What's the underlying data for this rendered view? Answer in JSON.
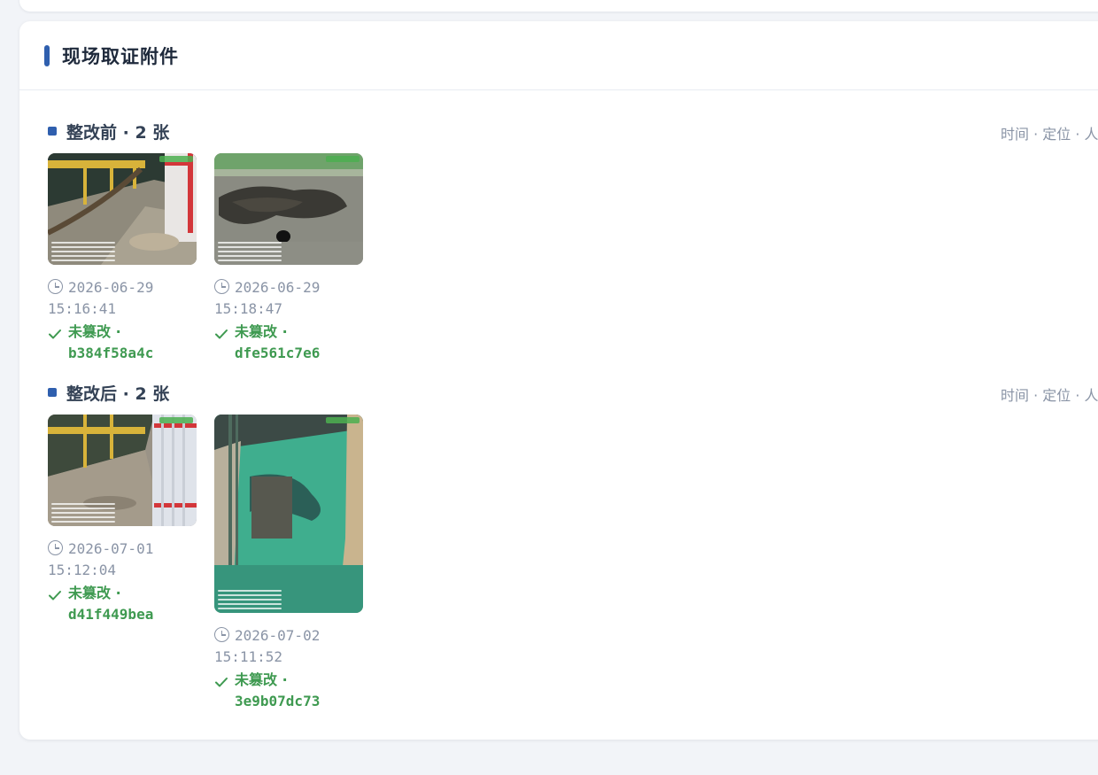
{
  "section": {
    "title": "现场取证附件"
  },
  "groups": [
    {
      "title": "整改前 · 2 张",
      "meta": "时间 · 定位 · 人",
      "photos": [
        {
          "date": "2026-06-29",
          "time": "15:16:41",
          "status": "未篡改 ·",
          "hash": "b384f58a4c"
        },
        {
          "date": "2026-06-29",
          "time": "15:18:47",
          "status": "未篡改 ·",
          "hash": "dfe561c7e6"
        }
      ]
    },
    {
      "title": "整改后 · 2 张",
      "meta": "时间 · 定位 · 人",
      "photos": [
        {
          "date": "2026-07-01",
          "time": "15:12:04",
          "status": "未篡改 ·",
          "hash": "d41f449bea"
        },
        {
          "date": "2026-07-02",
          "time": "15:11:52",
          "status": "未篡改 ·",
          "hash": "3e9b07dc73"
        }
      ]
    }
  ],
  "colors": {
    "accent": "#2f5fae",
    "success": "#3f9a51",
    "muted": "#8a94a6"
  },
  "icons": [
    "clock-icon",
    "check-icon"
  ]
}
